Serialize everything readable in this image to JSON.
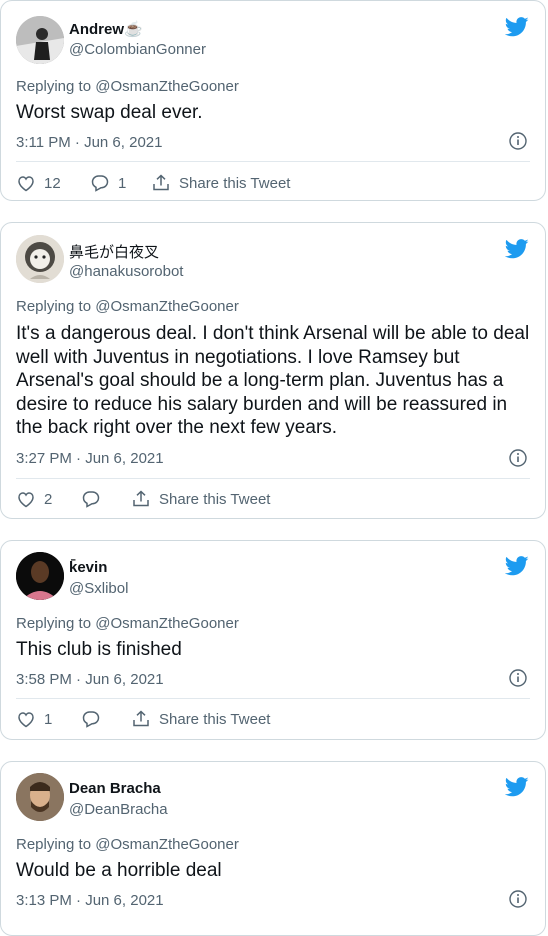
{
  "tweets": [
    {
      "name": "Andrew☕",
      "handle": "@ColombianGonner",
      "reply_prefix": "Replying to",
      "reply_to": "@OsmanZtheGooner",
      "text": "Worst swap deal ever.",
      "timestamp": "3:11 PM · Jun 6, 2021",
      "likes": "12",
      "replies": "1",
      "share_label": "Share this Tweet"
    },
    {
      "name": "鼻毛が白夜叉",
      "handle": "@hanakusorobot",
      "reply_prefix": "Replying to",
      "reply_to": "@OsmanZtheGooner",
      "text": "It's a dangerous deal.  I don't think Arsenal will be able to deal well with Juventus in negotiations.  I love Ramsey but Arsenal's goal should be a long-term plan.  Juventus has a desire to reduce his salary burden and will be reassured in the back right over the next few years.",
      "timestamp": "3:27 PM · Jun 6, 2021",
      "likes": "2",
      "replies": "",
      "share_label": "Share this Tweet"
    },
    {
      "name": "k̄evin",
      "handle": "@Sxlibol",
      "reply_prefix": "Replying to",
      "reply_to": "@OsmanZtheGooner",
      "text": "This club is finished",
      "timestamp": "3:58 PM · Jun 6, 2021",
      "likes": "1",
      "replies": "",
      "share_label": "Share this Tweet"
    },
    {
      "name": "Dean Bracha",
      "handle": "@DeanBracha",
      "reply_prefix": "Replying to",
      "reply_to": "@OsmanZtheGooner",
      "text": "Would be a horrible deal",
      "timestamp": "3:13 PM · Jun 6, 2021"
    }
  ],
  "colors": {
    "brand_blue": "#1d9bf0",
    "muted": "#536471",
    "border": "#cfd9de"
  },
  "icons": [
    "twitter-bird-icon",
    "info-icon",
    "heart-icon",
    "reply-bubble-icon",
    "share-icon"
  ]
}
